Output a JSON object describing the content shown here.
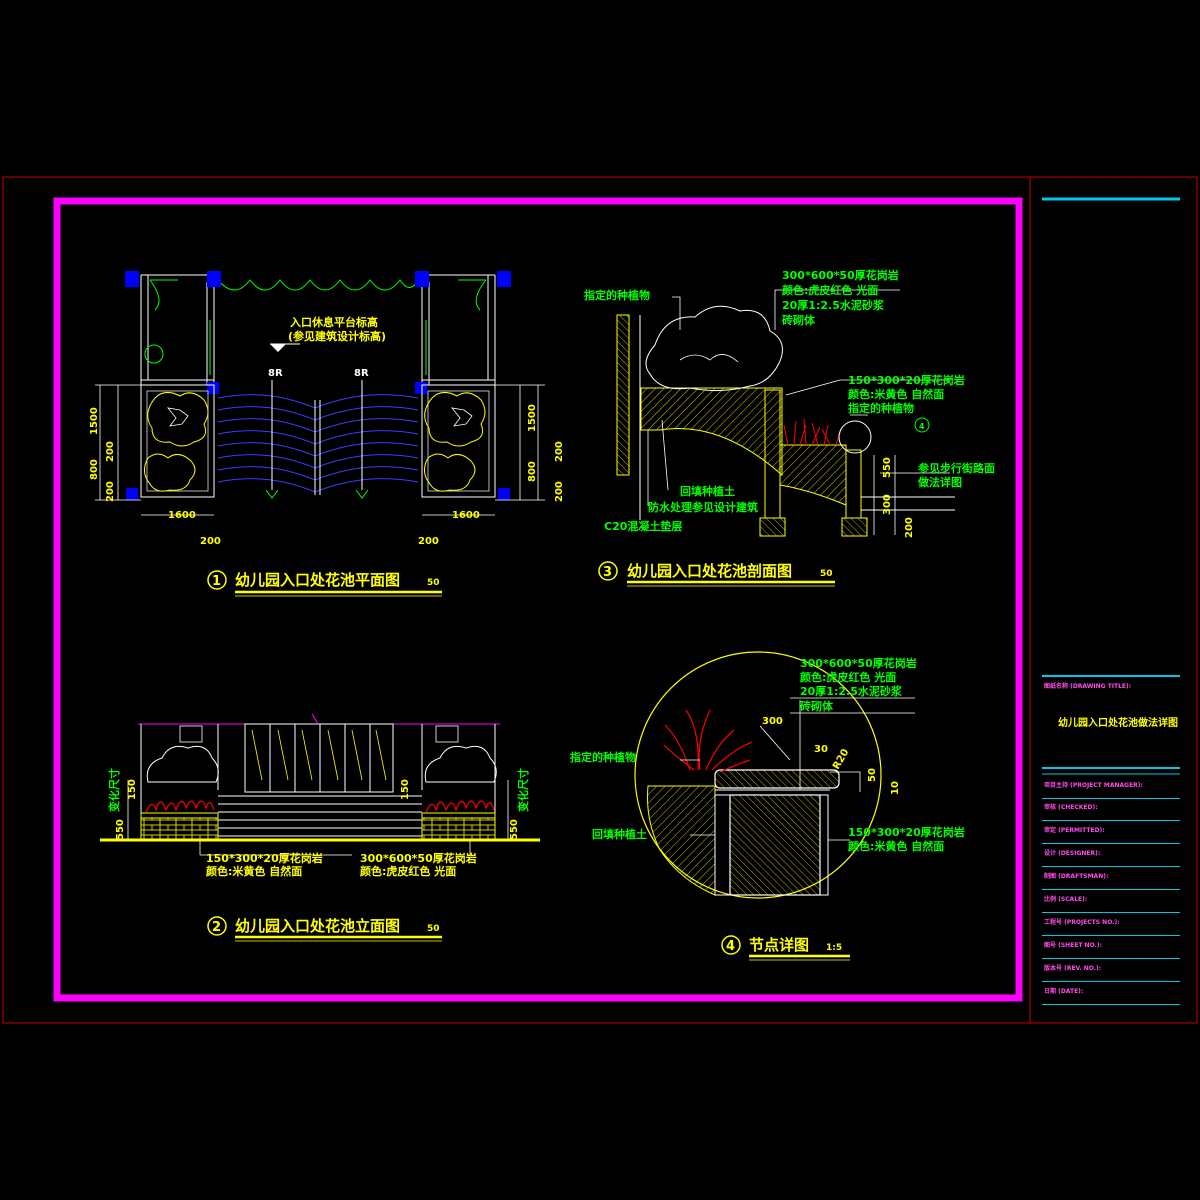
{
  "colors": {
    "background": "#000000",
    "outer_border": "#c80000",
    "inner_frame": "#ff00ff",
    "titleblock": "#00c8e6",
    "structure": "#ffffff",
    "plants": "#00ff00",
    "annotation": "#ffff00",
    "columns": "#0000ff",
    "flowers": "#ff0000",
    "title_bar": "#ffff00"
  },
  "views": {
    "plan": {
      "number": "1",
      "title": "幼儿园入口处花池平面图",
      "scale": "50",
      "note_line1": "入口休息平台标高",
      "note_line2": "(参见建筑设计标高)",
      "step_mark_left": "8R",
      "step_mark_right": "8R",
      "dim_left_1500": "1500",
      "dim_left_200": "200",
      "dim_left_800": "800",
      "dim_left_200b": "200",
      "dim_right_1500": "1500",
      "dim_right_200": "200",
      "dim_right_800": "800",
      "dim_right_200b": "200",
      "dim_bottom_left_1600": "1600",
      "dim_bottom_right_1600": "1600",
      "dim_bottom_left_200": "200",
      "dim_bottom_right_200": "200"
    },
    "elevation": {
      "number": "2",
      "title": "幼儿园入口处花池立面图",
      "scale": "50",
      "left_vertical": "变化尺寸",
      "right_vertical": "变化尺寸",
      "dim_150_left": "150",
      "dim_550_left": "550",
      "dim_150_right": "150",
      "dim_550_right": "550",
      "note_left_1": "150*300*20厚花岗岩",
      "note_left_2": "颜色:米黄色  自然面",
      "note_right_1": "300*600*50厚花岗岩",
      "note_right_2": "颜色:虎皮红色  光面"
    },
    "section": {
      "number": "3",
      "title": "幼儿园入口处花池剖面图",
      "scale": "50",
      "plant_label": "指定的种植物",
      "layer_1": "300*600*50厚花岗岩",
      "layer_2": "颜色:虎皮红色  光面",
      "layer_3": "20厚1:2.5水泥砂浆",
      "layer_4": "砖砌体",
      "mid_1": "150*300*20厚花岗岩",
      "mid_2": "颜色:米黄色  自然面",
      "mid_3": "指定的种植物",
      "ref_1": "参见步行街路面",
      "ref_2": "做法详图",
      "fill_soil": "回填种植土",
      "waterproof": "防水处理参见设计建筑",
      "base": "C20混凝土垫层",
      "dim_550": "550",
      "dim_300": "300",
      "dim_200": "200",
      "callout": "4"
    },
    "detail": {
      "number": "4",
      "title": "节点详图",
      "scale": "1:5",
      "layer_1": "300*600*50厚花岗岩",
      "layer_2": "颜色:虎皮红色  光面",
      "layer_3": "20厚1:2.5水泥砂浆",
      "layer_4": "砖砌体",
      "plant_label": "指定的种植物",
      "fill_soil": "回填种植土",
      "cap_1": "150*300*20厚花岗岩",
      "cap_2": "颜色:米黄色  自然面",
      "dim_300": "300",
      "dim_30": "30",
      "dim_r20": "R20",
      "dim_50": "50",
      "dim_10": "10"
    }
  },
  "titleblock": {
    "drawing_title_label": "图纸名称 (DRAWING TITLE):",
    "drawing_title": "幼儿园入口处花池做法详图",
    "rows": [
      "项目主持 (PROJECT MANAGER):",
      "审核 (CHECKED):",
      "审定 (PERMITTED):",
      "设计 (DESIGNER):",
      "制图 (DRAFTSMAN):",
      "比例 (SCALE):",
      "工程号 (PROJECTS NO.):",
      "图号 (SHEET NO.):",
      "版本号 (REV. NO.):",
      "日期 (DATE):"
    ]
  }
}
